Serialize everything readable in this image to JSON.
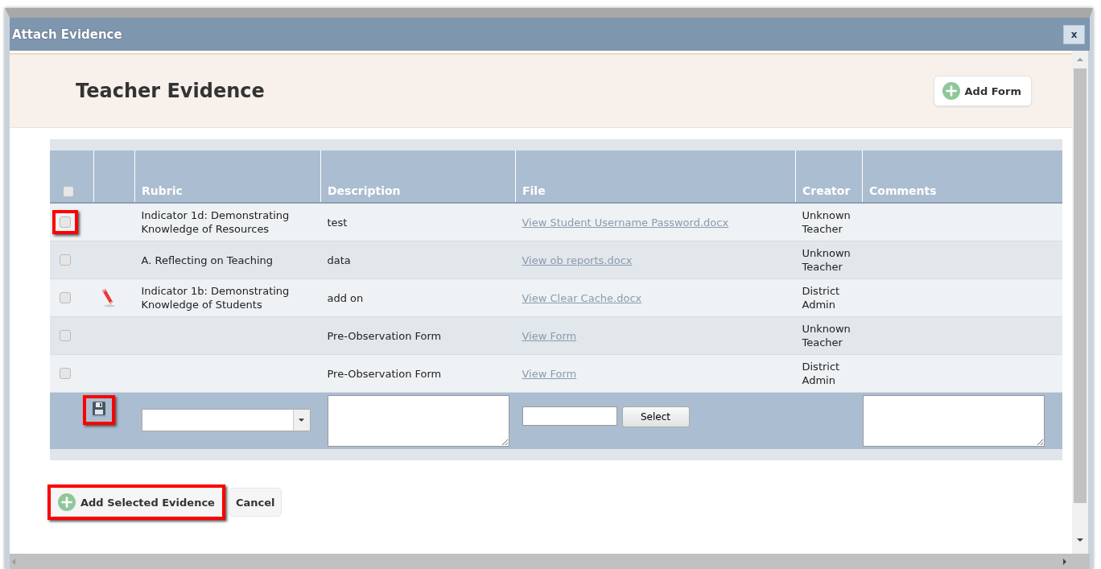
{
  "dialog": {
    "title": "Attach Evidence",
    "close": "x"
  },
  "header": {
    "title": "Teacher Evidence",
    "add_form": "Add Form"
  },
  "table": {
    "header_checkbox": {
      "checked": false
    },
    "columns": [
      "Rubric",
      "Description",
      "File",
      "Creator",
      "Comments"
    ],
    "rows": [
      {
        "checked": false,
        "highlighted": true,
        "editable": false,
        "rubric": "Indicator 1d: Demonstrating Knowledge of Resources",
        "description": "test",
        "file": "View Student Username Password.docx",
        "creator": "Unknown Teacher"
      },
      {
        "checked": false,
        "highlighted": false,
        "editable": false,
        "rubric": "A. Reflecting on Teaching",
        "description": "data",
        "file": "View ob reports.docx",
        "creator": "Unknown Teacher"
      },
      {
        "checked": false,
        "highlighted": false,
        "editable": true,
        "rubric": "Indicator 1b: Demonstrating Knowledge of Students",
        "description": "add on",
        "file": "View Clear Cache.docx",
        "creator": "District Admin"
      },
      {
        "checked": false,
        "highlighted": false,
        "editable": false,
        "rubric": "",
        "description": "Pre-Observation Form",
        "file": "View Form",
        "creator": "Unknown Teacher"
      },
      {
        "checked": false,
        "highlighted": false,
        "editable": false,
        "rubric": "",
        "description": "Pre-Observation Form",
        "file": "View Form",
        "creator": "District Admin"
      }
    ],
    "add_row": {
      "save_highlighted": true,
      "select_button": "Select"
    }
  },
  "buttons": [
    {
      "label": "Add Selected Evidence",
      "kind": "add",
      "highlighted": true
    },
    {
      "label": "Cancel",
      "kind": "plain",
      "highlighted": false
    }
  ]
}
